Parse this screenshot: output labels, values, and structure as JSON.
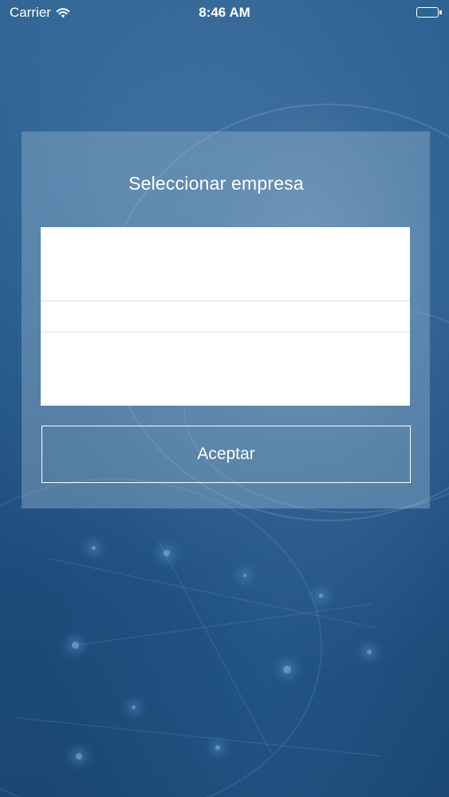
{
  "status_bar": {
    "carrier": "Carrier",
    "time": "8:46 AM",
    "wifi_icon": "wifi-icon",
    "battery_icon": "battery-icon"
  },
  "dialog": {
    "title": "Seleccionar empresa",
    "picker": {
      "selected_value": ""
    },
    "accept_label": "Aceptar"
  },
  "colors": {
    "background": "#1f4f7c",
    "panel": "rgba(150,180,205,0.42)",
    "text": "#ffffff"
  }
}
